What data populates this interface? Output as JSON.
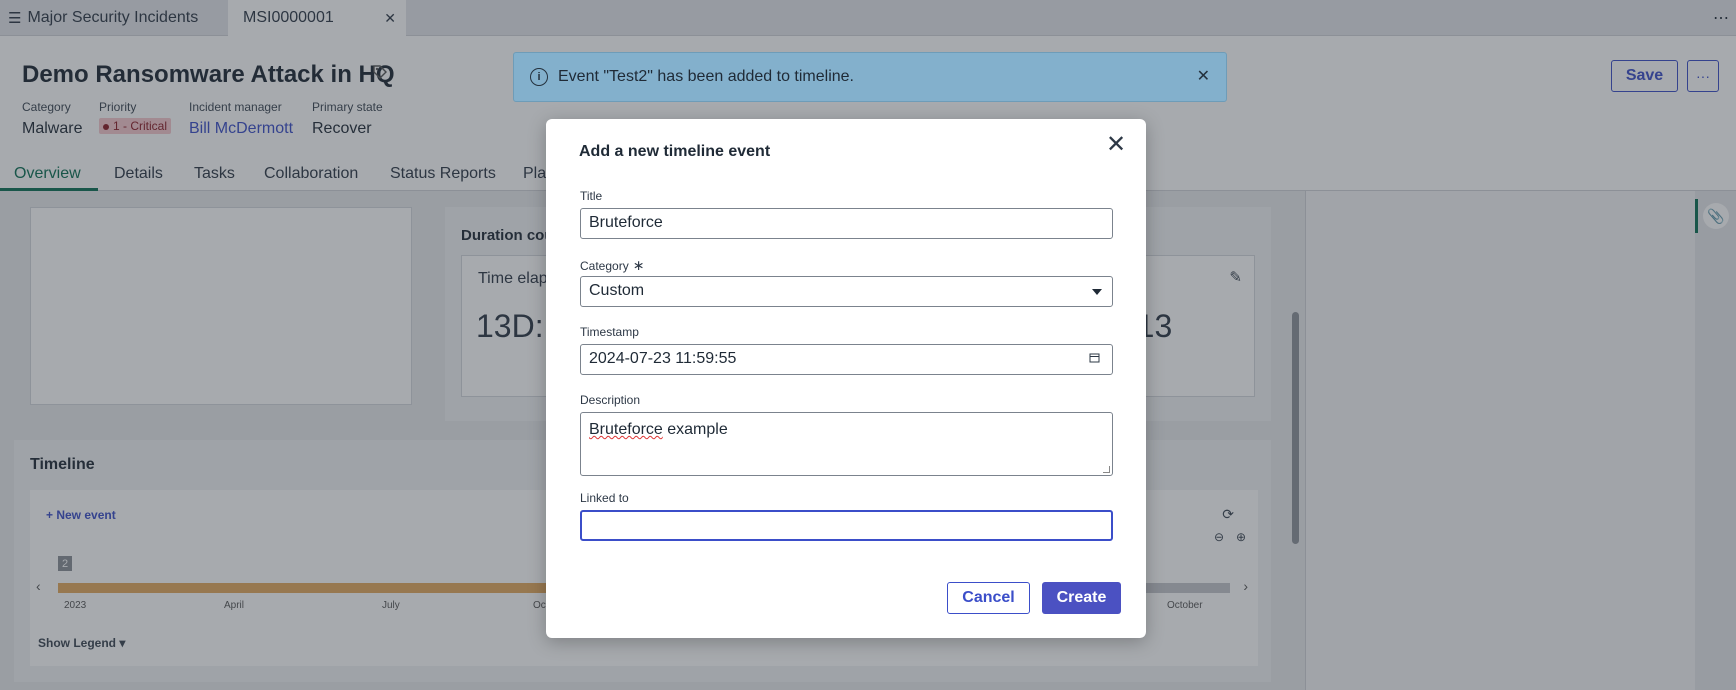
{
  "tabs": {
    "list_tab": "Major Security Incidents",
    "record_tab": "MSI0000001"
  },
  "incident": {
    "title": "Demo Ransomware Attack in HQ",
    "fields": [
      {
        "label": "Category",
        "value": "Malware"
      },
      {
        "label": "Priority",
        "value": "1 - Critical"
      },
      {
        "label": "Incident manager",
        "value": "Bill McDermott"
      },
      {
        "label": "Primary state",
        "value": "Recover"
      }
    ],
    "save_label": "Save",
    "more_label": "···"
  },
  "nav": {
    "tabs": [
      "Overview",
      "Details",
      "Tasks",
      "Collaboration",
      "Status Reports",
      "Pla"
    ]
  },
  "duration": {
    "title": "Duration cou",
    "label": "Time elap",
    "value_left": "13D:",
    "value_right": "-13"
  },
  "timeline": {
    "title": "Timeline",
    "new_event": "+ New event",
    "count": "2",
    "axis_labels": [
      "2023",
      "April",
      "July",
      "Oc",
      "October"
    ],
    "legend_toggle": "Show Legend",
    "filled_fraction": 0.45
  },
  "toast": {
    "message": "Event \"Test2\" has been added to timeline."
  },
  "modal": {
    "title": "Add a new timeline event",
    "title_label": "Title",
    "title_value": "Bruteforce",
    "category_label": "Category",
    "category_value": "Custom",
    "timestamp_label": "Timestamp",
    "timestamp_value": "2024-07-23 11:59:55",
    "description_label": "Description",
    "description_word1": "Bruteforce",
    "description_word2": " example",
    "linked_label": "Linked to",
    "linked_value": "",
    "cancel_label": "Cancel",
    "create_label": "Create"
  },
  "colors": {
    "accent": "#3b4ec9",
    "primary_button": "#4b51c2",
    "active_tab": "#0c6e53",
    "toast_bg": "#83b0cc",
    "critical_badge": "#f7c9cd",
    "timeline_fill": "#e3aa5d"
  }
}
